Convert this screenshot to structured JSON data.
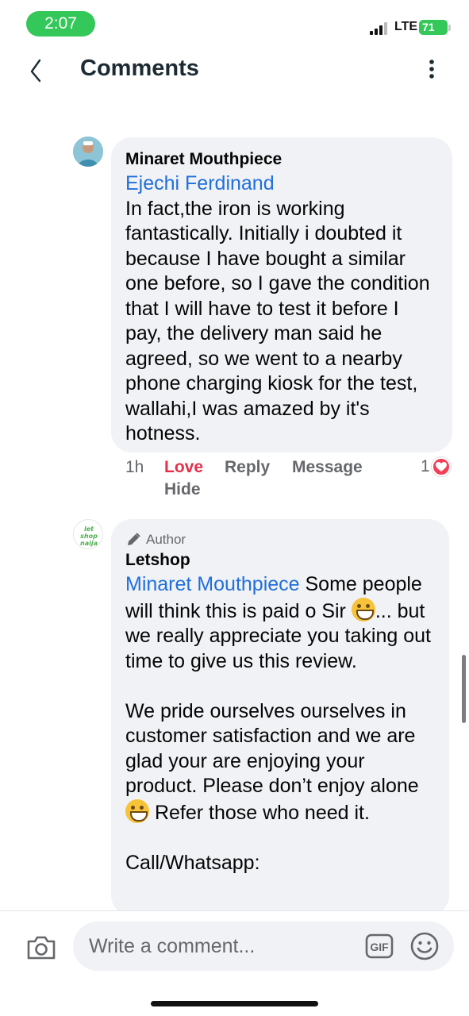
{
  "status_bar": {
    "time": "2:07",
    "network": "LTE",
    "battery": "71",
    "battery_color": "#34c759"
  },
  "header": {
    "title": "Comments",
    "back_icon": "chevron-left-icon",
    "more_icon": "vertical-dots-icon"
  },
  "comments": [
    {
      "author": "Minaret Mouthpiece",
      "mention": "Ejechi Ferdinand",
      "text": "In fact,the iron is working fantastically. Initially i doubted it because I have bought a similar one before, so I gave the condition that I will have to test it before I pay, the delivery man said he agreed, so we went to a nearby phone charging kiosk for the test, wallahi,I was amazed by it's hotness.",
      "time": "1h",
      "reaction_label": "Love",
      "reply_label": "Reply",
      "message_label": "Message",
      "hide_label": "Hide",
      "reaction_count": "1",
      "reaction_icon": "heart-icon",
      "reaction_color": "#f33e58"
    },
    {
      "badge": "Author",
      "badge_icon": "pencil-icon",
      "author": "Letshop",
      "avatar_text": "let shop naija",
      "mention": "Minaret Mouthpiece",
      "text_1": " Some people will think this is paid o Sir ",
      "text_2": "... but we really appreciate you taking out time to give us this review.",
      "text_3": "We pride ourselves ourselves in customer satisfaction and we are glad your are enjoying your product. Please don’t enjoy alone ",
      "text_4": " Refer those who need it.",
      "text_5": "Call/Whatsapp:",
      "emoji_icon": "grinning-face-icon"
    }
  ],
  "composer": {
    "placeholder": "Write a comment...",
    "camera_icon": "camera-icon",
    "gif_label": "GIF",
    "emoji_icon": "smiley-icon"
  },
  "colors": {
    "accent_link": "#216fdb",
    "love": "#e6304a",
    "bubble_bg": "#f0f2f5",
    "muted_text": "#65676b"
  }
}
